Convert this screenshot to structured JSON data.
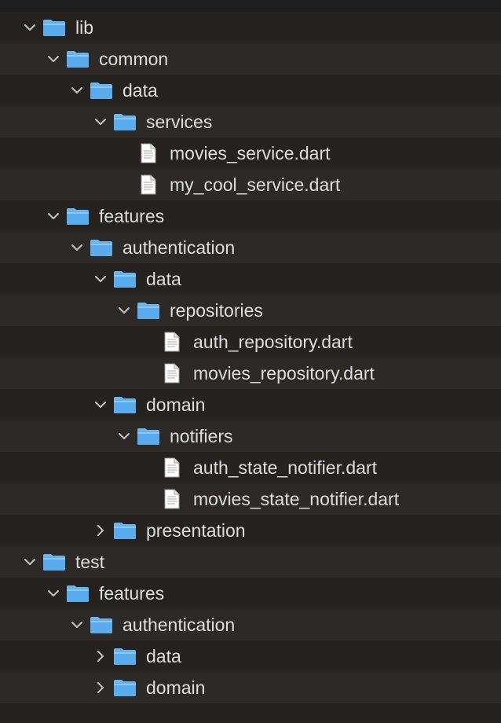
{
  "tree": {
    "lib": "lib",
    "common": "common",
    "common_data": "data",
    "services": "services",
    "movies_service": "movies_service.dart",
    "my_cool_service": "my_cool_service.dart",
    "features": "features",
    "authentication": "authentication",
    "auth_data": "data",
    "repositories": "repositories",
    "auth_repository": "auth_repository.dart",
    "movies_repository": "movies_repository.dart",
    "domain": "domain",
    "notifiers": "notifiers",
    "auth_state_notifier": "auth_state_notifier.dart",
    "movies_state_notifier": "movies_state_notifier.dart",
    "presentation": "presentation",
    "test": "test",
    "test_features": "features",
    "test_authentication": "authentication",
    "test_data": "data",
    "test_domain": "domain"
  },
  "colors": {
    "folder_light": "#7cc0f4",
    "folder_dark": "#4aa3e8",
    "chevron": "#bdbdbd",
    "text": "#dedede"
  }
}
